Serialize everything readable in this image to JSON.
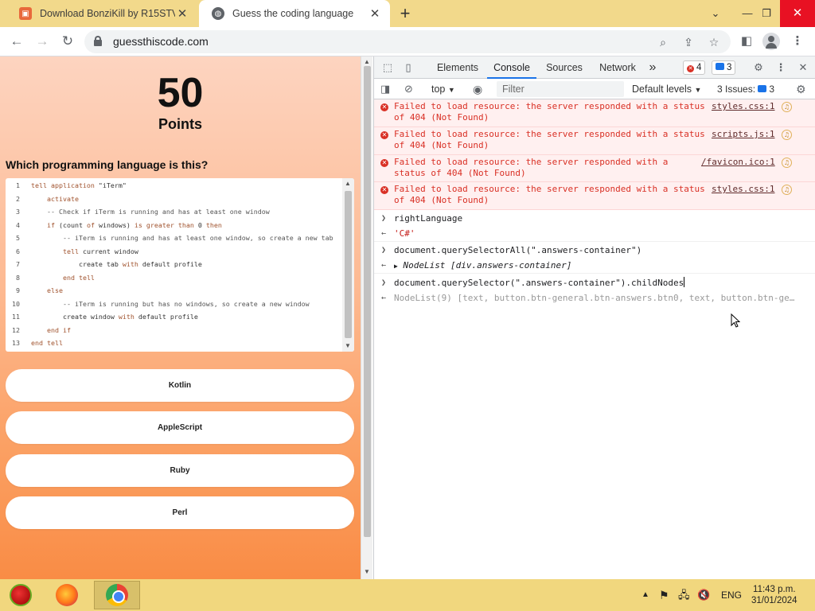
{
  "browser": {
    "tabs": [
      {
        "title": "Download BonziKill by R15STV - ",
        "icon": "bonzi-favicon"
      },
      {
        "title": "Guess the coding language",
        "icon": "globe-favicon"
      }
    ],
    "url": "guessthiscode.com"
  },
  "page": {
    "points": "50",
    "points_label": "Points",
    "question": "Which programming language is this?",
    "code_lines": [
      {
        "n": "1",
        "indent": 0,
        "parts": [
          [
            "kw",
            "tell application "
          ],
          [
            "tx",
            "\"iTerm\""
          ]
        ]
      },
      {
        "n": "2",
        "indent": 1,
        "parts": [
          [
            "kw",
            "activate"
          ]
        ]
      },
      {
        "n": "3",
        "indent": 1,
        "parts": [
          [
            "cm",
            "-- Check if iTerm is running and has at least one window"
          ]
        ]
      },
      {
        "n": "4",
        "indent": 1,
        "parts": [
          [
            "kw",
            "if "
          ],
          [
            "tx",
            "(count "
          ],
          [
            "kw",
            "of "
          ],
          [
            "tx",
            "windows) "
          ],
          [
            "kw",
            "is greater than "
          ],
          [
            "tx",
            "0 "
          ],
          [
            "kw",
            "then"
          ]
        ]
      },
      {
        "n": "5",
        "indent": 2,
        "parts": [
          [
            "cm",
            "-- iTerm is running and has at least one window, so create a new tab"
          ]
        ]
      },
      {
        "n": "6",
        "indent": 2,
        "parts": [
          [
            "kw",
            "tell "
          ],
          [
            "tx",
            "current window"
          ]
        ]
      },
      {
        "n": "7",
        "indent": 3,
        "parts": [
          [
            "tx",
            "create tab "
          ],
          [
            "kw",
            "with "
          ],
          [
            "tx",
            "default profile"
          ]
        ]
      },
      {
        "n": "8",
        "indent": 2,
        "parts": [
          [
            "kw",
            "end tell"
          ]
        ]
      },
      {
        "n": "9",
        "indent": 1,
        "parts": [
          [
            "kw",
            "else"
          ]
        ]
      },
      {
        "n": "10",
        "indent": 2,
        "parts": [
          [
            "cm",
            "-- iTerm is running but has no windows, so create a new window"
          ]
        ]
      },
      {
        "n": "11",
        "indent": 2,
        "parts": [
          [
            "tx",
            "create window "
          ],
          [
            "kw",
            "with "
          ],
          [
            "tx",
            "default profile"
          ]
        ]
      },
      {
        "n": "12",
        "indent": 1,
        "parts": [
          [
            "kw",
            "end if"
          ]
        ]
      },
      {
        "n": "13",
        "indent": 0,
        "parts": [
          [
            "kw",
            "end tell"
          ]
        ]
      }
    ],
    "answers": [
      "Kotlin",
      "AppleScript",
      "Ruby",
      "Perl"
    ]
  },
  "devtools": {
    "tabs": [
      "Elements",
      "Console",
      "Sources",
      "Network"
    ],
    "active_tab": "Console",
    "more": "»",
    "error_count": "4",
    "message_count": "3",
    "context": "top",
    "filter_placeholder": "Filter",
    "levels": "Default levels",
    "issues_label": "3 Issues:",
    "issues_count": "3",
    "errors": [
      {
        "line1": "Failed to load resource: the server responded with a status",
        "line2": "of 404 (Not Found)",
        "source": "styles.css:1"
      },
      {
        "line1": "Failed to load resource: the server responded with a status",
        "line2": "of 404 (Not Found)",
        "source": "scripts.js:1"
      },
      {
        "line1": "Failed to load resource: the server responded with a",
        "line2": "status of 404 (Not Found)",
        "source": "/favicon.ico:1"
      },
      {
        "line1": "Failed to load resource: the server responded with a status",
        "line2": "of 404 (Not Found)",
        "source": "styles.css:1"
      }
    ],
    "entries": {
      "in1": "rightLanguage",
      "out1": "'C#'",
      "in2": "document.querySelectorAll(\".answers-container\")",
      "out2": "NodeList [div.answers-container]",
      "in3": "document.querySelector(\".answers-container\").childNodes",
      "preview3": "NodeList(9) [text, button.btn-general.btn-answers.btn0, text, button.btn-ge…"
    }
  },
  "taskbar": {
    "lang": "ENG",
    "time": "11:43 p.m.",
    "date": "31/01/2024"
  },
  "colors": {
    "tab_strip": "#f2d98b",
    "error_red": "#d93025",
    "accent_blue": "#1a73e8",
    "taskbar": "#f1d77e"
  }
}
